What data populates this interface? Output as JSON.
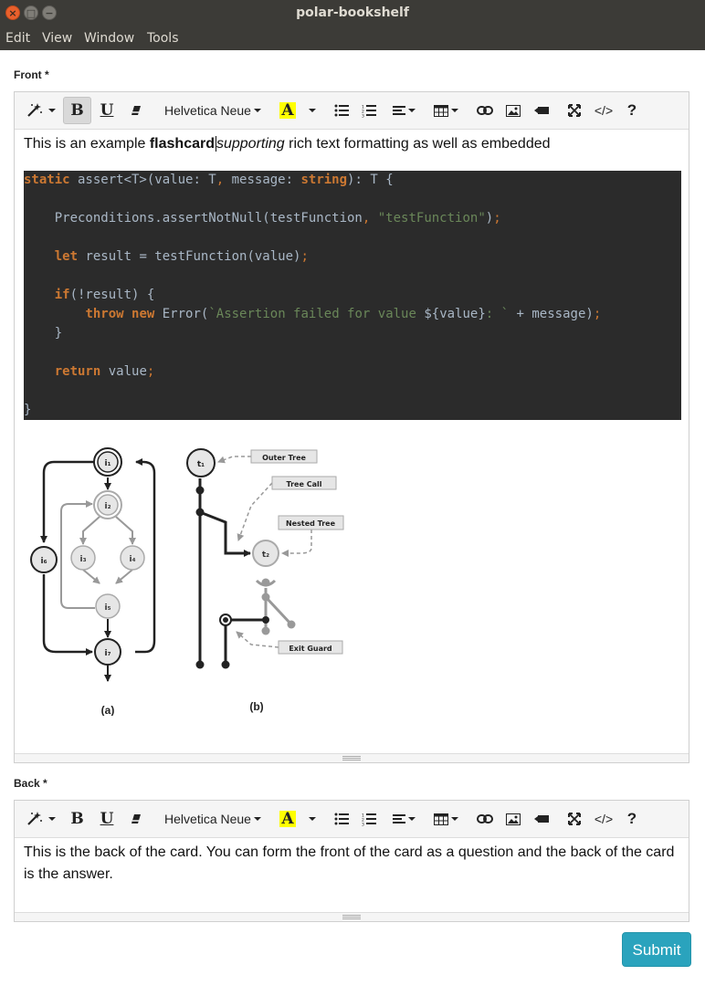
{
  "window": {
    "title": "polar-bookshelf",
    "close": "×",
    "maximize": "□",
    "minimize": "−"
  },
  "menu": [
    "Edit",
    "View",
    "Window",
    "Tools"
  ],
  "toolbar": {
    "font": "Helvetica Neue",
    "bold": "B",
    "underline": "U",
    "code": "</>",
    "help": "?",
    "text_color": "A"
  },
  "front": {
    "label": "Front *",
    "text_plain": "This is an example ",
    "text_bold": "flashcard",
    "text_italic": "supporting",
    "text_rest": " rich text formatting as well as embedded",
    "code_lines": [
      [
        [
          "kw",
          "static"
        ],
        [
          "t",
          " assert<T>(value: T"
        ],
        [
          "pn",
          ","
        ],
        [
          "t",
          " message: "
        ],
        [
          "kw",
          "string"
        ],
        [
          "t",
          "): T {"
        ]
      ],
      [],
      [
        [
          "t",
          "    Preconditions.assertNotNull(testFunction"
        ],
        [
          "pn",
          ","
        ],
        [
          "t",
          " "
        ],
        [
          "str",
          "\"testFunction\""
        ],
        [
          "t",
          ")"
        ],
        [
          "pn",
          ";"
        ]
      ],
      [],
      [
        [
          "t",
          "    "
        ],
        [
          "kw",
          "let"
        ],
        [
          "t",
          " result = testFunction(value)"
        ],
        [
          "pn",
          ";"
        ]
      ],
      [],
      [
        [
          "t",
          "    "
        ],
        [
          "kw",
          "if"
        ],
        [
          "t",
          "(!result) {"
        ]
      ],
      [
        [
          "t",
          "        "
        ],
        [
          "kw",
          "throw"
        ],
        [
          "t",
          " "
        ],
        [
          "kw",
          "new"
        ],
        [
          "t",
          " Error("
        ],
        [
          "str",
          "`Assertion failed for value "
        ],
        [
          "t",
          "${value}"
        ],
        [
          "str",
          ": `"
        ],
        [
          "t",
          " + message)"
        ],
        [
          "pn",
          ";"
        ]
      ],
      [
        [
          "t",
          "    }"
        ]
      ],
      [],
      [
        [
          "t",
          "    "
        ],
        [
          "kw",
          "return"
        ],
        [
          "t",
          " value"
        ],
        [
          "pn",
          ";"
        ]
      ],
      [],
      [
        [
          "t",
          "}"
        ]
      ]
    ],
    "diagram": {
      "caption_a": "(a)",
      "caption_b": "(b)",
      "nodes_a": [
        "i₁",
        "i₂",
        "i₃",
        "i₄",
        "i₅",
        "i₆",
        "i₇"
      ],
      "nodes_b": [
        "t₁",
        "t₂"
      ],
      "callouts": [
        "Outer Tree",
        "Tree Call",
        "Nested Tree",
        "Exit Guard"
      ]
    }
  },
  "back": {
    "label": "Back *",
    "text": "This is the back of the card. You can form the front of the card as a question and the back of the card is the answer."
  },
  "submit_label": "Submit",
  "colors": {
    "code_bg": "#2b2b2b",
    "keyword": "#cc7832",
    "string": "#6a8759",
    "submit": "#2aa3bd",
    "titlebar": "#3c3b37"
  }
}
